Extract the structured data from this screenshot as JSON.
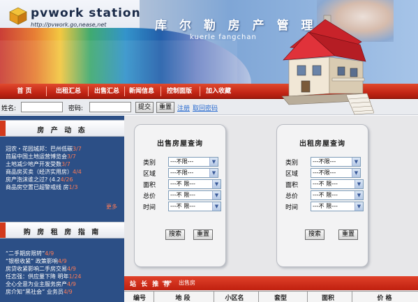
{
  "header": {
    "logo_text": "pvwork station",
    "logo_url": "http://pvwork.go,nease,net",
    "title": "库 尔 勒 房 产 管 理",
    "subtitle": "kuerle fangchan"
  },
  "nav": {
    "items": [
      "首  页",
      "出租汇总",
      "出售汇总",
      "新闻信息",
      "控制面版",
      "加入收藏"
    ]
  },
  "login": {
    "name_label": "姓名:",
    "password_label": "密码:",
    "submit_label": "提交",
    "reset_label": "重置",
    "register_label": "注册",
    "forgot_label": "取回密码"
  },
  "news": {
    "title": "房 产 动 态",
    "items": [
      {
        "text": "冠农・花园城邦：巴州低碳",
        "date": "3/7"
      },
      {
        "text": "首届中国土地运营博览会",
        "date": "3/7"
      },
      {
        "text": "土地减少地产开发受数",
        "date": "3/7"
      },
      {
        "text": "商品房买卖（经济实用房）",
        "date": "4/4"
      },
      {
        "text": "房产泡沫谁之过? (4.2",
        "date": "4/26"
      },
      {
        "text": "商品房空置已超警戒线 房",
        "date": "1/3"
      }
    ],
    "more_label": "更多"
  },
  "guide": {
    "title": "购 房 租 房 指 南",
    "items": [
      {
        "text": "“二手期房限转”",
        "date": "4/9"
      },
      {
        "text": "“银根收紧” 政策影响",
        "date": "4/9"
      },
      {
        "text": "房贷收紧影响二手房交易",
        "date": "4/9"
      },
      {
        "text": "任志强：供应量下降 明年",
        "date": "1/24"
      },
      {
        "text": "全心全意为业主服务房产",
        "date": "4/9"
      },
      {
        "text": "房介知“黑社会” 业务员",
        "date": "4/9"
      }
    ]
  },
  "sale_query": {
    "title": "出售房屋查询",
    "rows": [
      {
        "label": "类别",
        "value": "---不限---"
      },
      {
        "label": "区域",
        "value": "---不限---"
      },
      {
        "label": "面积",
        "value": "---不  限---"
      },
      {
        "label": "总价",
        "value": "---不  限---"
      },
      {
        "label": "时间",
        "value": "---不  限---"
      }
    ],
    "search_label": "搜索",
    "reset_label": "重置"
  },
  "rent_query": {
    "title": "出租房屋查询",
    "rows": [
      {
        "label": "类别",
        "value": "---不限---"
      },
      {
        "label": "区域",
        "value": "---不限---"
      },
      {
        "label": "面积",
        "value": "---不  限---"
      },
      {
        "label": "总价",
        "value": "---不  限---"
      },
      {
        "label": "时间",
        "value": "---不  限---"
      }
    ],
    "search_label": "搜索",
    "reset_label": "重置"
  },
  "recommend": {
    "title": "站 长 推 荐",
    "arrow": "⟹",
    "subtitle": "出售房",
    "columns": [
      "编号",
      "地    段",
      "小区名",
      "套型",
      "面积",
      "价  格"
    ]
  },
  "colors": {
    "nav_red": "#c42616",
    "left_blue": "#2c4f86",
    "date_orange": "#ff7b55",
    "link_blue": "#2a6cd0"
  },
  "icons": [
    "logo-cube-icon",
    "house-illustration",
    "chevron-down-icon"
  ]
}
